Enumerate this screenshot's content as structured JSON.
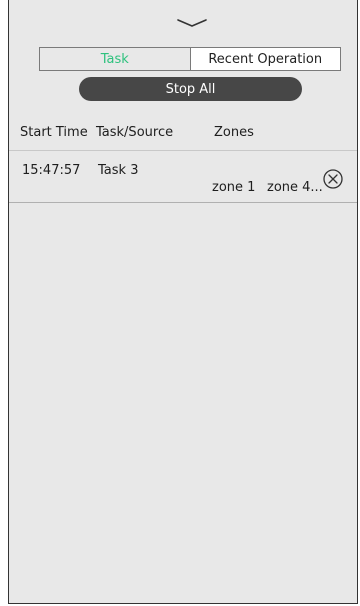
{
  "icons": {
    "handle": "chevron-down-icon",
    "cancel": "close-circle-icon"
  },
  "colors": {
    "panel_background": "#e8e8e8",
    "active_tab_text": "#2ec27e",
    "stop_button": "#474747"
  },
  "tabs": [
    {
      "label": "Task",
      "active": true
    },
    {
      "label": "Recent Operation",
      "active": false
    }
  ],
  "stop_all_label": "Stop All",
  "table": {
    "headers": {
      "start_time": "Start Time",
      "task_source": "Task/Source",
      "zones": "Zones"
    },
    "rows": [
      {
        "start_time": "15:47:57",
        "task_source": "Task 3",
        "zones": [
          "zone 1",
          "zone 4..."
        ]
      }
    ]
  }
}
